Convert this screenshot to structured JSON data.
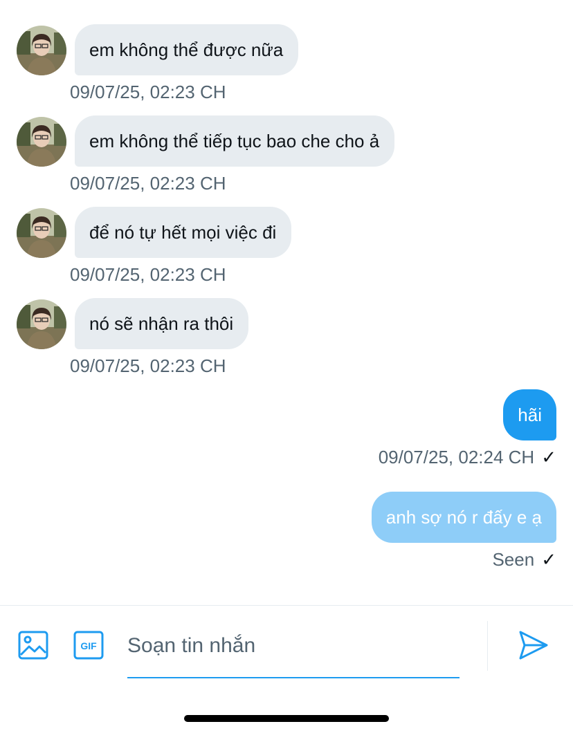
{
  "messages": [
    {
      "direction": "in",
      "text": "em không thể được nữa",
      "timestamp": "09/07/25, 02:23 CH"
    },
    {
      "direction": "in",
      "text": "em không thể tiếp tục bao che cho ả",
      "timestamp": "09/07/25, 02:23 CH"
    },
    {
      "direction": "in",
      "text": "để nó tự hết mọi việc đi",
      "timestamp": "09/07/25, 02:23 CH"
    },
    {
      "direction": "in",
      "text": "nó sẽ nhận ra thôi",
      "timestamp": "09/07/25, 02:23 CH"
    },
    {
      "direction": "out",
      "text": "hãi",
      "timestamp": "09/07/25, 02:24 CH",
      "status_icon": "checkmark-icon"
    },
    {
      "direction": "out",
      "text": "anh sợ nó r đấy e ạ",
      "status": "Seen",
      "status_icon": "checkmark-icon"
    }
  ],
  "composer": {
    "placeholder": "Soạn tin nhắn",
    "icons": [
      "image-icon",
      "gif-icon",
      "send-icon"
    ]
  },
  "colors": {
    "accent": "#1d9bf0",
    "pending_bubble": "#8ecdf8",
    "incoming_bubble": "#e7ecf0",
    "secondary_text": "#536471"
  }
}
